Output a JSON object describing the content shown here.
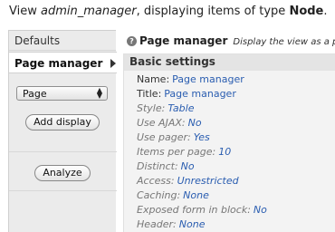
{
  "caption": {
    "prefix": "View ",
    "view_name": "admin_manager",
    "middle": ", displaying items of type ",
    "type": "Node",
    "suffix": "."
  },
  "sidebar": {
    "tabs": [
      {
        "label": "Defaults"
      },
      {
        "label": "Page manager"
      }
    ],
    "display_select": {
      "value": "Page"
    },
    "add_display_label": "Add display",
    "analyze_label": "Analyze"
  },
  "main": {
    "header_title": "Page manager",
    "header_desc": "Display the view as a p",
    "section_title": "Basic settings",
    "rows": [
      {
        "label": "Name:",
        "value": "Page manager"
      },
      {
        "label": "Title:",
        "value": "Page manager"
      },
      {
        "label": "Style:",
        "value": "Table"
      },
      {
        "label": "Use AJAX:",
        "value": "No"
      },
      {
        "label": "Use pager:",
        "value": "Yes"
      },
      {
        "label": "Items per page:",
        "value": "10"
      },
      {
        "label": "Distinct:",
        "value": "No"
      },
      {
        "label": "Access:",
        "value": "Unrestricted"
      },
      {
        "label": "Caching:",
        "value": "None"
      },
      {
        "label": "Exposed form in block:",
        "value": "No"
      },
      {
        "label": "Header:",
        "value": "None"
      }
    ]
  }
}
